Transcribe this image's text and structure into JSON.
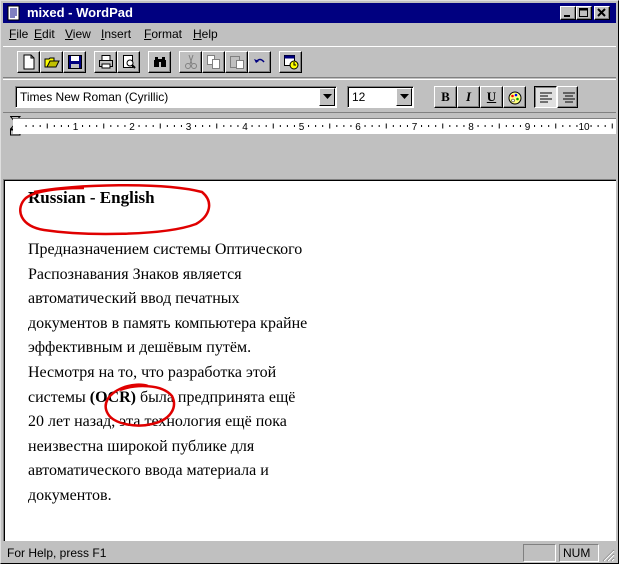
{
  "window": {
    "title": "mixed - WordPad"
  },
  "menu": [
    "File",
    "Edit",
    "View",
    "Insert",
    "Format",
    "Help"
  ],
  "format_bar": {
    "font_name": "Times New Roman (Cyrillic)",
    "font_size": "12",
    "bold_label": "B",
    "italic_label": "I",
    "underline_label": "U"
  },
  "ruler": {
    "numbers": [
      "1",
      "2",
      "3",
      "4",
      "5",
      "6",
      "7",
      "8",
      "9",
      "10"
    ]
  },
  "document": {
    "heading": "Russian - English",
    "lines": [
      "Предназначением системы Оптического",
      "Распознавания Знаков является",
      "автоматический ввод печатных",
      "документов в память компьютера крайне",
      "эффективным и дешёвым путём.",
      "Несмотря на то, что разработка этой"
    ],
    "line7_before": "системы ",
    "line7_bold": "(OCR)",
    "line7_after": " была предпринята ещё",
    "lines_tail": [
      "20 лет назад, эта технология ещё пока",
      "неизвестна широкой публике для",
      "автоматического ввода материала и",
      "документов."
    ]
  },
  "status": {
    "help_text": "For Help, press F1",
    "num_indicator": "NUM"
  },
  "colors": {
    "titlebar": "#000080",
    "annotation": "#e00000",
    "face": "#c0c0c0"
  },
  "icons": [
    "wordpad-app-icon",
    "minimize-icon",
    "maximize-icon",
    "close-icon",
    "new-icon",
    "open-icon",
    "save-icon",
    "print-icon",
    "print-preview-icon",
    "find-icon",
    "cut-icon",
    "copy-icon",
    "paste-icon",
    "undo-icon",
    "date-time-icon",
    "bold-icon",
    "italic-icon",
    "underline-icon",
    "color-icon",
    "align-left-icon",
    "align-center-icon"
  ]
}
